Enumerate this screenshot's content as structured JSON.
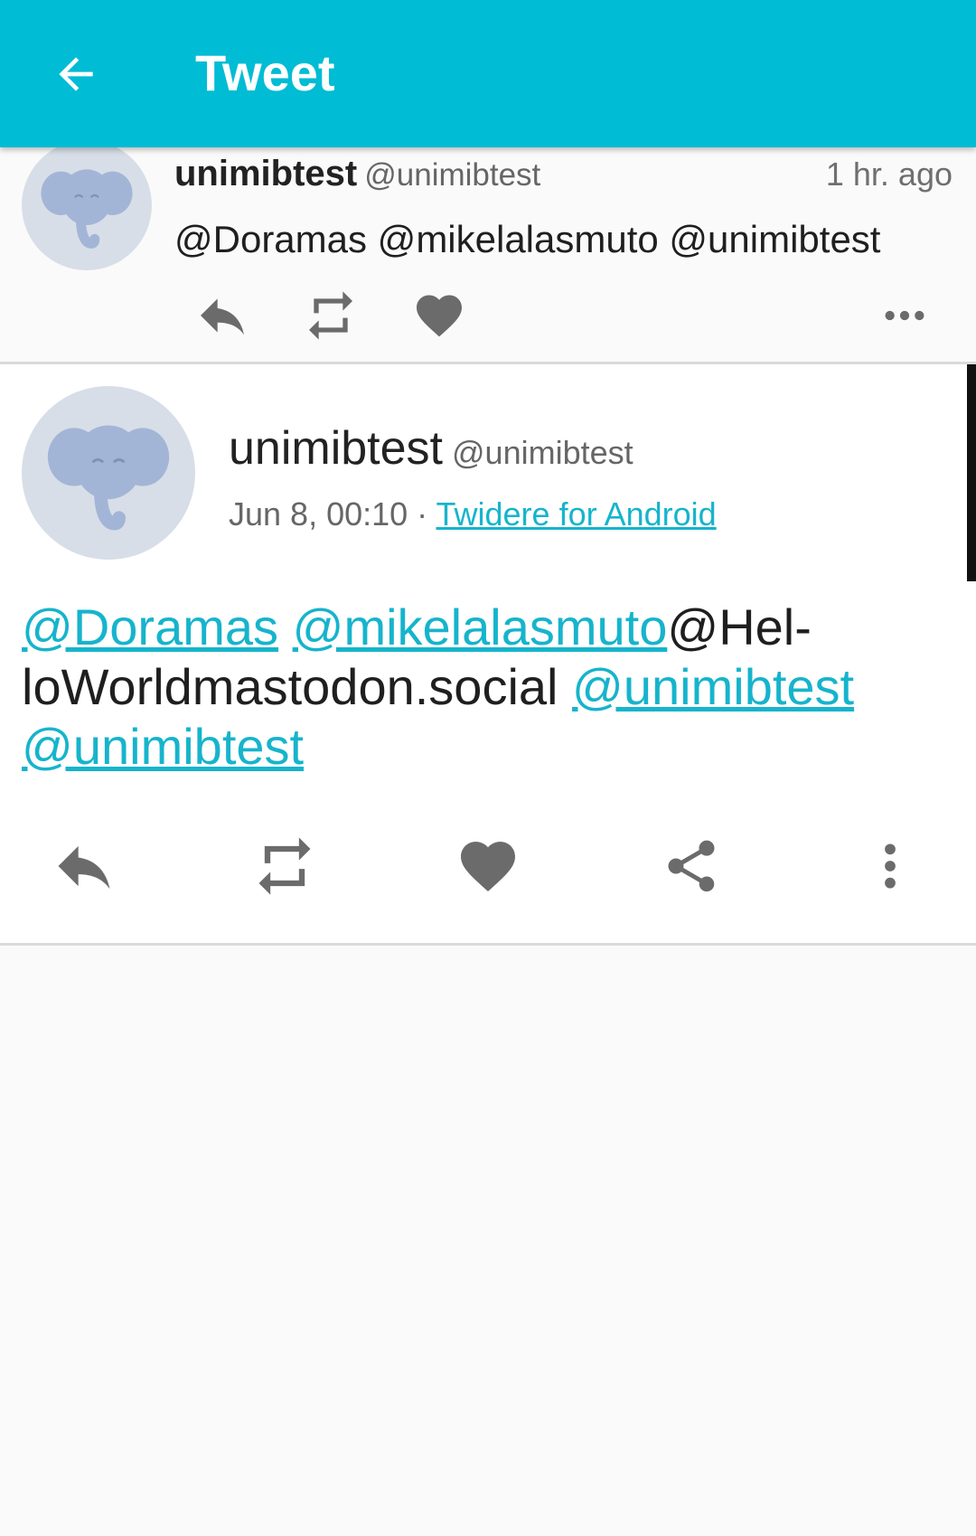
{
  "appbar": {
    "title": "Tweet",
    "back_icon": "arrow-back-icon",
    "background": "#00bcd4"
  },
  "parent_tweet": {
    "name": "unimibtest",
    "handle": "@unimibtest",
    "time": "1 hr. ago",
    "text": "@Doramas @mikelalasmuto @unimibtest",
    "actions": [
      "reply-icon",
      "retweet-icon",
      "favorite-icon",
      "more-horizontal-icon"
    ]
  },
  "detail_tweet": {
    "name": "unimibtest",
    "handle": "@unimibtest",
    "date": "Jun 8, 00:10",
    "separator": " · ",
    "source": "Twidere for Android",
    "body": {
      "mention_1": "@Doramas",
      "space_1": " ",
      "mention_2": "@mikelalasmuto",
      "plain_1": "@Hel-",
      "plain_2": "loWorldmastodon.social",
      "space_2": " ",
      "mention_3": "@unimibtest",
      "mention_4": "@unimibtest"
    },
    "actions": [
      "reply-icon",
      "retweet-icon",
      "favorite-icon",
      "share-icon",
      "more-vertical-icon"
    ]
  },
  "colors": {
    "accent": "#00bcd4",
    "link": "#16b4cc",
    "icon": "#6b6b6b",
    "avatar_bg": "#d7dee8",
    "elephant": "#a3b5d6"
  }
}
